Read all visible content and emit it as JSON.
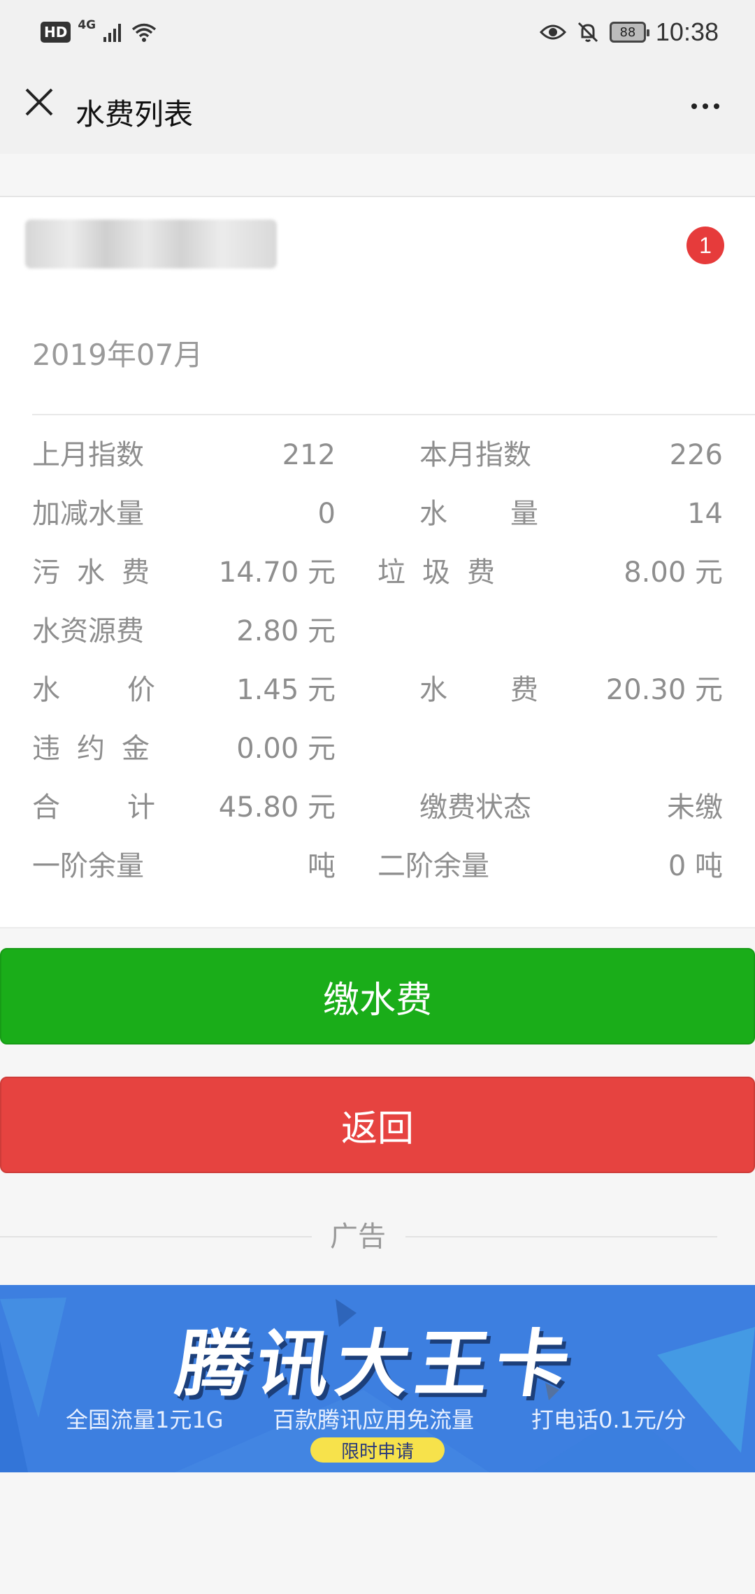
{
  "status_bar": {
    "hd": "HD",
    "network": "4G",
    "battery": "88",
    "time": "10:38"
  },
  "header": {
    "title": "水费列表",
    "close_icon": "close-icon",
    "more_icon": "more-icon"
  },
  "account": {
    "badge": "1"
  },
  "bill": {
    "period": "2019年07月",
    "rows": [
      {
        "label_left": "上月指数",
        "value_left": "212",
        "label_right": "本月指数",
        "value_right": "226"
      },
      {
        "label_left": "加减水量",
        "value_left": "0",
        "label_right": "水量",
        "value_right": "14"
      },
      {
        "label_left": "污水费",
        "value_left": "14.70 元",
        "label_right": "垃圾费",
        "value_right": "8.00 元"
      },
      {
        "label_left": "水资源费",
        "value_left": "2.80 元",
        "label_right": "",
        "value_right": ""
      },
      {
        "label_left": "水价",
        "value_left": "1.45 元",
        "label_right": "水费",
        "value_right": "20.30 元"
      },
      {
        "label_left": "违约金",
        "value_left": "0.00 元",
        "label_right": "",
        "value_right": ""
      },
      {
        "label_left": "合计",
        "value_left": "45.80 元",
        "label_right": "缴费状态",
        "value_right": "未缴"
      },
      {
        "label_left": "一阶余量",
        "value_left": "吨",
        "label_right": "二阶余量",
        "value_right": "0 吨"
      }
    ]
  },
  "actions": {
    "pay_label": "缴水费",
    "back_label": "返回"
  },
  "ad": {
    "section_label": "广告",
    "title": "腾讯大王卡",
    "features": [
      "全国流量1元1G",
      "百款腾讯应用免流量",
      "打电话0.1元/分"
    ],
    "cta": "限时申请"
  },
  "colors": {
    "pay_button": "#1aad19",
    "back_button": "#e64340",
    "badge": "#e63b3b",
    "ad_background": "#3d7fe0"
  }
}
